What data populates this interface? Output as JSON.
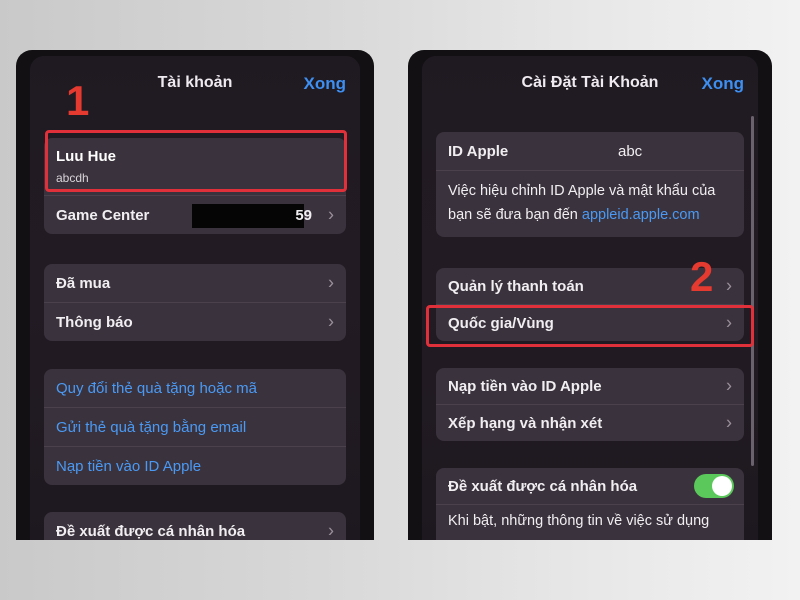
{
  "left": {
    "title": "Tài khoản",
    "done": "Xong",
    "step": "1",
    "profile": {
      "name": "Luu Hue",
      "sub": "abcdh"
    },
    "game_center": {
      "label": "Game Center",
      "trailing": "59"
    },
    "group2": [
      "Đã mua",
      "Thông báo"
    ],
    "links": [
      "Quy đổi thẻ quà tặng hoặc mã",
      "Gửi thẻ quà tặng bằng email",
      "Nạp tiền vào ID Apple"
    ],
    "personalized": "Đề xuất được cá nhân hóa"
  },
  "right": {
    "title": "Cài Đặt Tài Khoản",
    "done": "Xong",
    "step": "2",
    "apple_id": {
      "label": "ID Apple",
      "value": "abc"
    },
    "info_text": "Việc hiệu chỉnh ID Apple và mật khẩu của bạn sẽ đưa bạn đến",
    "info_link": "appleid.apple.com",
    "group2": [
      "Quản lý thanh toán",
      "Quốc gia/Vùng"
    ],
    "group3": [
      "Nạp tiền vào ID Apple",
      "Xếp hạng và nhận xét"
    ],
    "personalized": "Đề xuất được cá nhân hóa",
    "personalized_desc": "Khi bật, những thông tin về việc sử dụng"
  },
  "colors": {
    "accent": "#3d8ff2",
    "highlight": "#e0313a",
    "toggle": "#5ac85a"
  }
}
